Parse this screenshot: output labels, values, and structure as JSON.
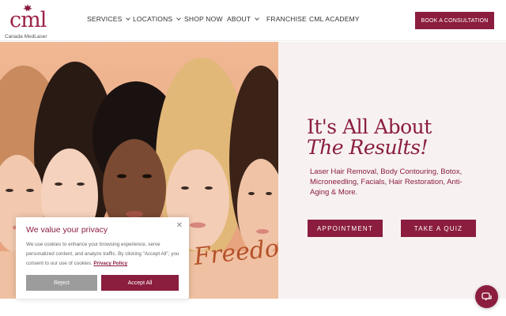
{
  "brand": {
    "logo_mark": "cml",
    "logo_text": "Canada MedLaser",
    "accent_color": "#8b1d3e"
  },
  "nav": {
    "items": [
      {
        "label": "SERVICES",
        "has_dropdown": true
      },
      {
        "label": "LOCATIONS",
        "has_dropdown": true
      },
      {
        "label": "SHOP NOW",
        "has_dropdown": false
      },
      {
        "label": "ABOUT",
        "has_dropdown": true
      },
      {
        "label": "FRANCHISE",
        "has_dropdown": false
      },
      {
        "label": "CML ACADEMY",
        "has_dropdown": false
      }
    ],
    "cta_label": "BOOK A CONSULTATION"
  },
  "hero": {
    "title_line1": "It's All About",
    "title_line2": "The Results!",
    "description": "Laser Hair Removal, Body Contouring, Botox, Microneedling, Facials, Hair Restoration, Anti-Aging & More.",
    "primary_button": "APPOINTMENT",
    "secondary_button": "TAKE A QUIZ",
    "image_overlay_text": "Freedom"
  },
  "cookie_banner": {
    "title": "We value your privacy",
    "body": "We use cookies to enhance your browsing experience, serve personalized content, and analyze traffic. By clicking \"Accept All\", you consent to our use of cookies.",
    "link_label": "Privacy Policy",
    "reject_label": "Reject",
    "accept_label": "Accept All",
    "close_icon": "close-icon"
  },
  "chat": {
    "icon": "chat-bubble-icon"
  }
}
